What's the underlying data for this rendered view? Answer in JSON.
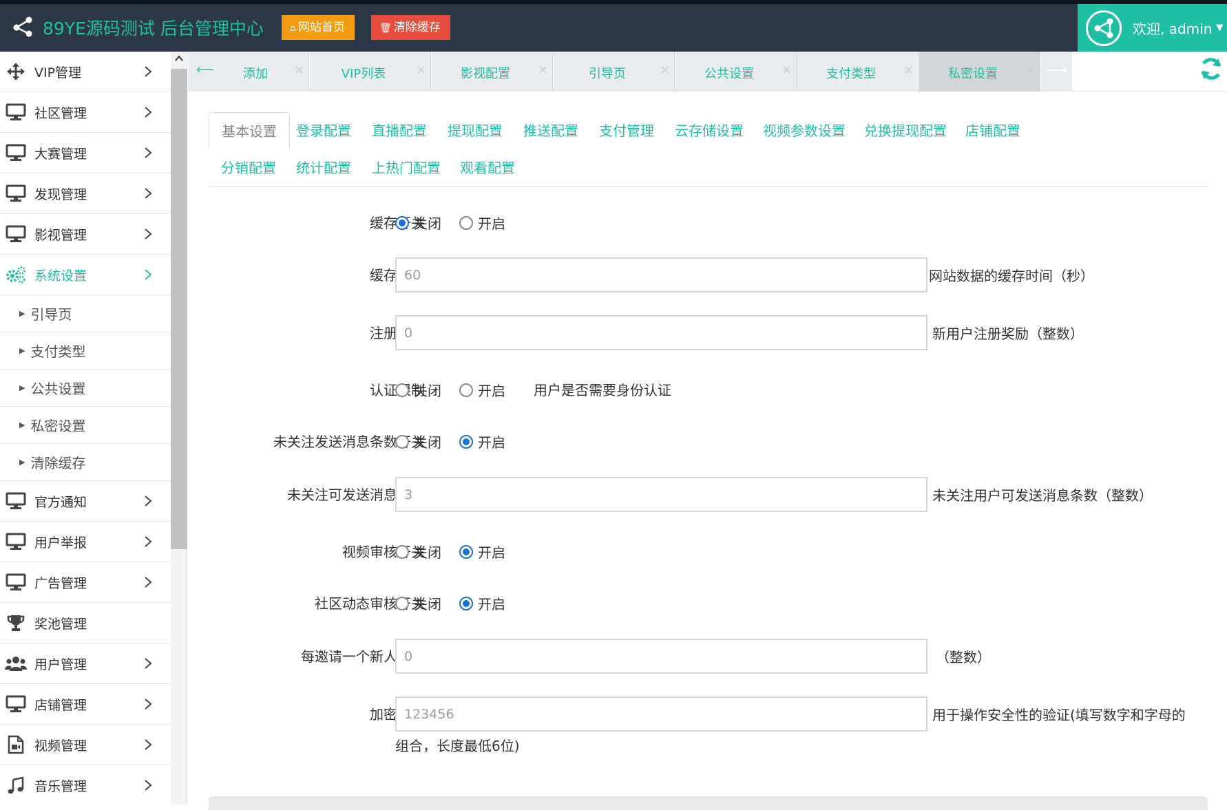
{
  "header": {
    "title": "89YE源码测试 后台管理中心",
    "home_button": "网站首页",
    "clear_cache_button": "清除缓存",
    "welcome": "欢迎, admin",
    "accent_color": "#1fbfa5"
  },
  "sidebar": {
    "items": [
      {
        "label": "VIP管理",
        "icon": "arrows-move-icon",
        "has_arrow": true
      },
      {
        "label": "社区管理",
        "icon": "monitor-icon",
        "has_arrow": true
      },
      {
        "label": "大赛管理",
        "icon": "monitor-icon",
        "has_arrow": true
      },
      {
        "label": "发现管理",
        "icon": "monitor-icon",
        "has_arrow": true
      },
      {
        "label": "影视管理",
        "icon": "monitor-icon",
        "has_arrow": true
      },
      {
        "label": "系统设置",
        "icon": "gears-icon",
        "has_arrow": true,
        "active": true
      }
    ],
    "sub_items": [
      {
        "label": "引导页"
      },
      {
        "label": "支付类型"
      },
      {
        "label": "公共设置"
      },
      {
        "label": "私密设置"
      },
      {
        "label": "清除缓存"
      }
    ],
    "items_after": [
      {
        "label": "官方通知",
        "icon": "monitor-icon",
        "has_arrow": true
      },
      {
        "label": "用户举报",
        "icon": "monitor-icon",
        "has_arrow": true
      },
      {
        "label": "广告管理",
        "icon": "monitor-icon",
        "has_arrow": true
      },
      {
        "label": "奖池管理",
        "icon": "trophy-icon",
        "has_arrow": false
      },
      {
        "label": "用户管理",
        "icon": "users-icon",
        "has_arrow": true
      },
      {
        "label": "店铺管理",
        "icon": "monitor-icon",
        "has_arrow": true
      },
      {
        "label": "视频管理",
        "icon": "video-file-icon",
        "has_arrow": true
      },
      {
        "label": "音乐管理",
        "icon": "music-icon",
        "has_arrow": true
      }
    ]
  },
  "tabs": [
    {
      "label": "添加"
    },
    {
      "label": "VIP列表"
    },
    {
      "label": "影视配置"
    },
    {
      "label": "引导页"
    },
    {
      "label": "公共设置"
    },
    {
      "label": "支付类型"
    },
    {
      "label": "私密设置",
      "active": true
    }
  ],
  "sub_tabs": [
    {
      "label": "基本设置",
      "active": true
    },
    {
      "label": "登录配置"
    },
    {
      "label": "直播配置"
    },
    {
      "label": "提现配置"
    },
    {
      "label": "推送配置"
    },
    {
      "label": "支付管理"
    },
    {
      "label": "云存储设置"
    },
    {
      "label": "视频参数设置"
    },
    {
      "label": "兑换提现配置"
    },
    {
      "label": "店铺配置"
    },
    {
      "label": "分销配置"
    },
    {
      "label": "统计配置"
    },
    {
      "label": "上热门配置"
    },
    {
      "label": "观看配置"
    }
  ],
  "form": {
    "off_label": "关闭",
    "on_label": "开启",
    "cache_switch": {
      "label": "缓存开关",
      "value": "off"
    },
    "cache_time": {
      "label": "缓存时间",
      "value": "60",
      "help": "网站数据的缓存时间（秒）"
    },
    "register_reward": {
      "label": "注册奖励",
      "value": "0",
      "help": "新用户注册奖励（整数）"
    },
    "auth_limit": {
      "label": "认证限制",
      "value": "none",
      "help": "用户是否需要身份认证"
    },
    "unfollow_msg_switch": {
      "label": "未关注发送消息条数开关",
      "value": "on"
    },
    "unfollow_msg_count": {
      "label": "未关注可发送消息条数",
      "value": "3",
      "help": "未关注用户可发送消息条数（整数）"
    },
    "video_review": {
      "label": "视频审核开关",
      "value": "on"
    },
    "community_review": {
      "label": "社区动态审核开关",
      "value": "on"
    },
    "invite_reward": {
      "label": "每邀请一个新人奖励",
      "value": "0",
      "help": "（整数）"
    },
    "secret_key": {
      "label": "加密秘钥",
      "value": "123456",
      "help_line1": "用于操作安全性的验证(填写数字和字母的",
      "help_line2": "组合，长度最低6位)"
    }
  }
}
